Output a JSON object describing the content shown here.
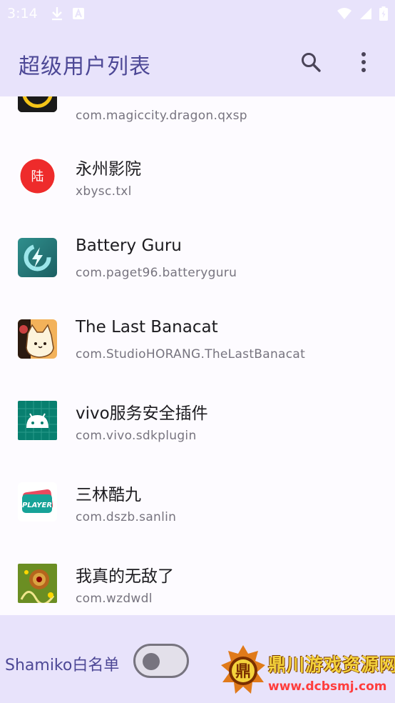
{
  "status_bar": {
    "time": "3:14",
    "left_icons": [
      "download-icon",
      "a-badge-icon"
    ],
    "right_icons": [
      "wifi-icon",
      "signal-icon",
      "battery-icon"
    ]
  },
  "appbar": {
    "title": "超级用户列表",
    "actions": [
      "search-icon",
      "more-vert-icon"
    ]
  },
  "apps": [
    {
      "name": "",
      "package": "com.magiccity.dragon.qxsp",
      "icon": "play-circle-icon"
    },
    {
      "name": "永州影院",
      "package": "xbysc.txl",
      "icon": "red-circle-icon",
      "icon_text": "陆"
    },
    {
      "name": "Battery Guru",
      "package": "com.paget96.batteryguru",
      "icon": "battery-guru-icon"
    },
    {
      "name": "The Last Banacat",
      "package": "com.StudioHORANG.TheLastBanacat",
      "icon": "cat-icon"
    },
    {
      "name": "vivo服务安全插件",
      "package": "com.vivo.sdkplugin",
      "icon": "android-icon"
    },
    {
      "name": "三林酷九",
      "package": "com.dszb.sanlin",
      "icon": "player-icon",
      "icon_text": "PLAYER"
    },
    {
      "name": "我真的无敌了",
      "package": "com.wzdwdl",
      "icon": "game-art-icon"
    }
  ],
  "bottom": {
    "shamiko_label": "Shamiko白名单",
    "switch_on": false
  },
  "watermark": {
    "line1": "鼎川游戏资源网",
    "line2": "www.dcbsmj.com",
    "logo_text": "鼎"
  },
  "colors": {
    "appbar_bg": "#e8e3fb",
    "title": "#4d4896",
    "secondary_text": "#77747f"
  }
}
